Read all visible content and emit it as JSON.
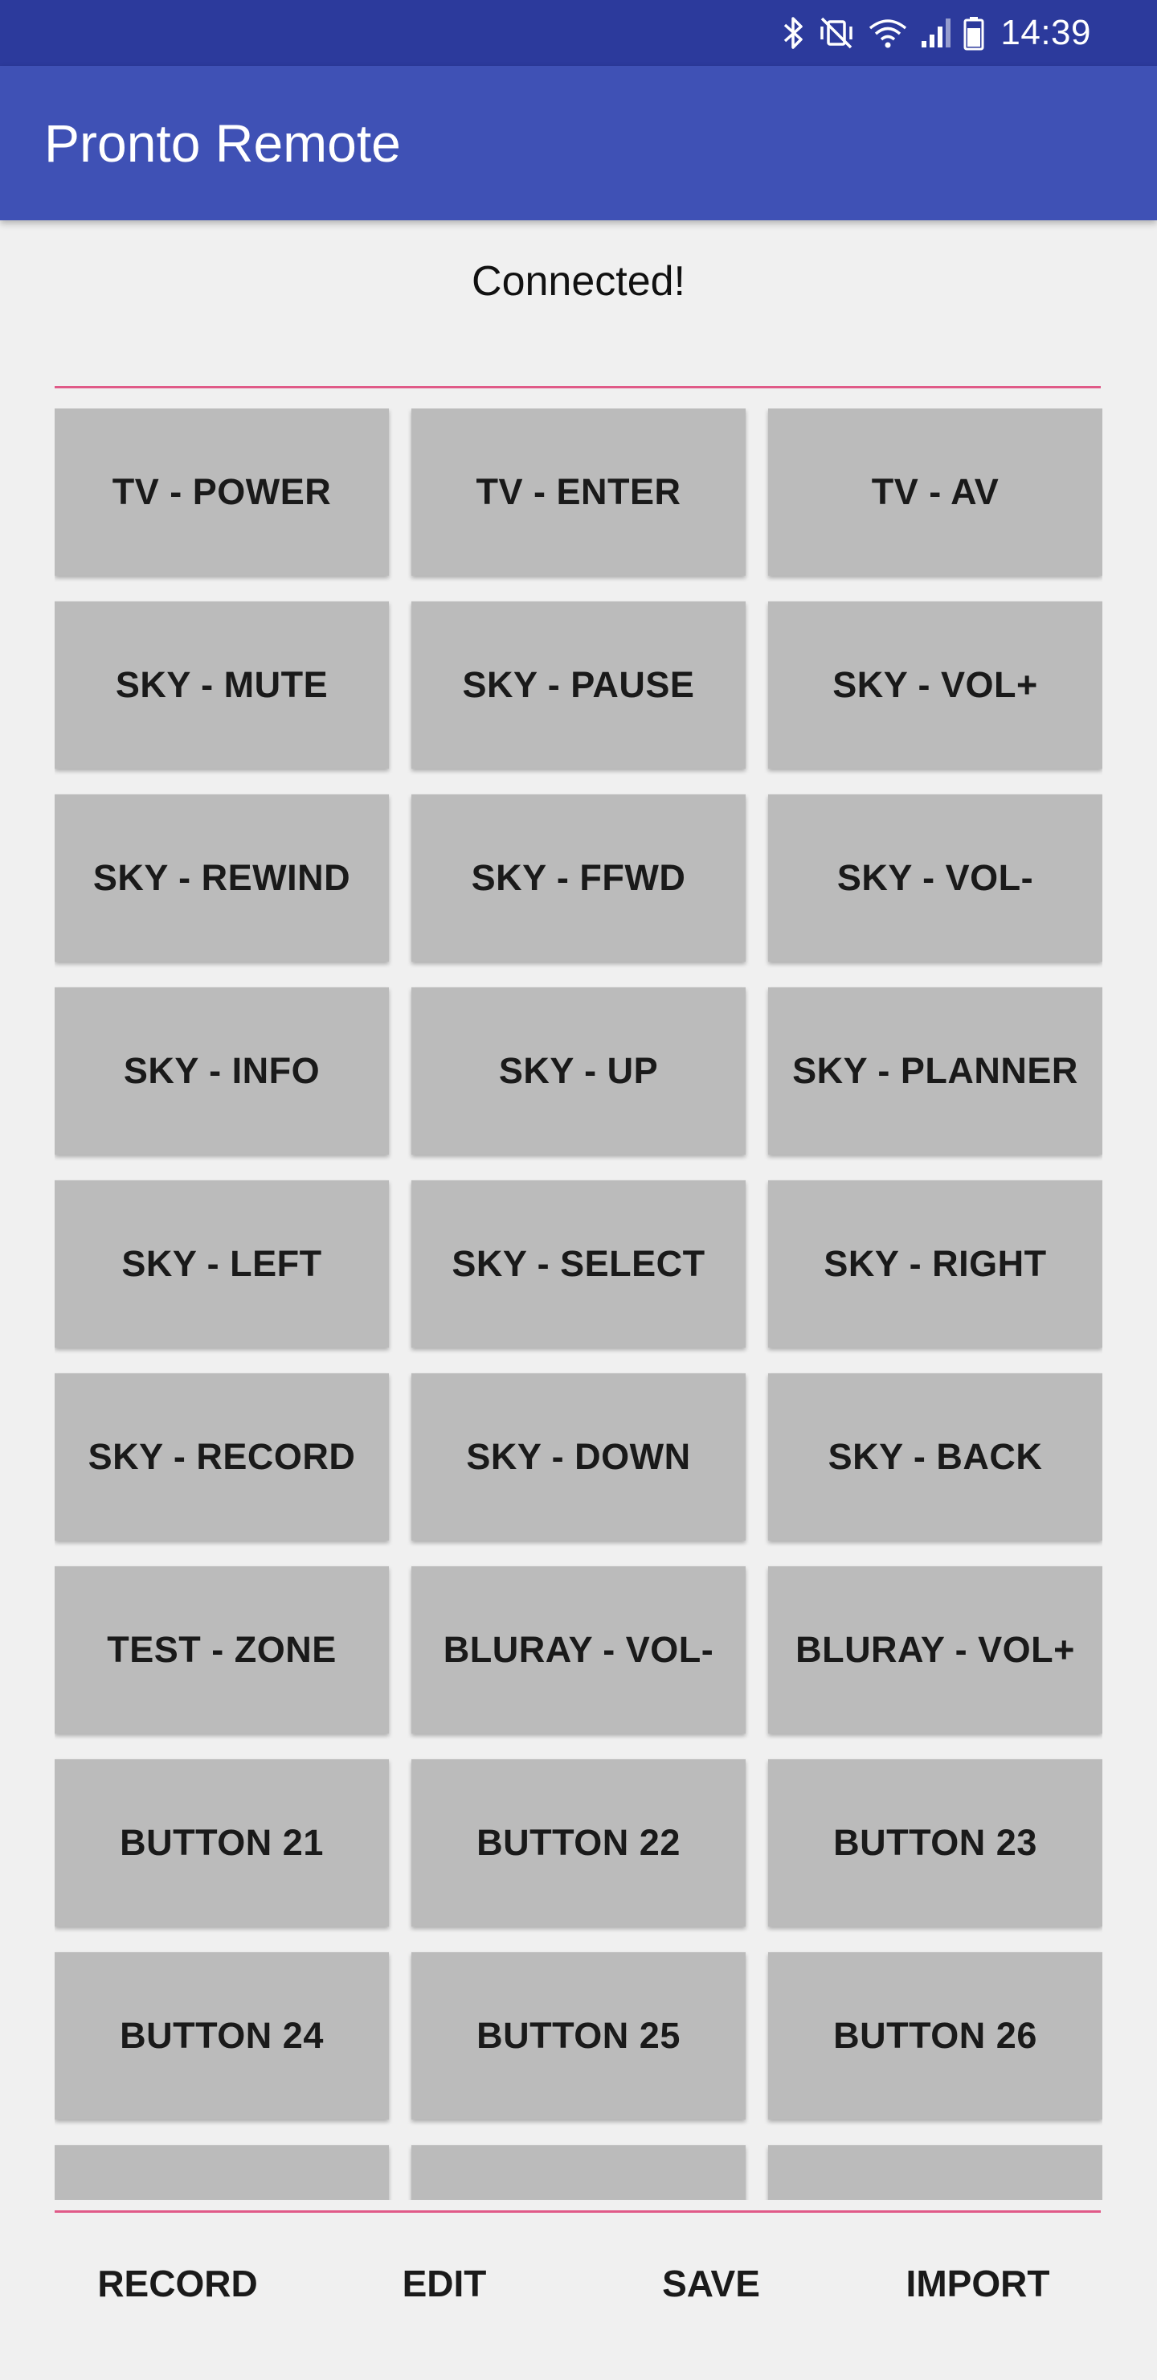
{
  "status_bar": {
    "time": "14:39",
    "icons": [
      "bluetooth-icon",
      "vibrate-mute-icon",
      "wifi-icon",
      "cell-signal-icon",
      "battery-icon"
    ]
  },
  "app_bar": {
    "title": "Pronto Remote"
  },
  "connection": {
    "status": "Connected!"
  },
  "buttons": [
    "TV - POWER",
    "TV - ENTER",
    "TV - AV",
    "SKY - MUTE",
    "SKY - PAUSE",
    "SKY - VOL+",
    "SKY - REWIND",
    "SKY - FFWD",
    "SKY - VOL-",
    "SKY - INFO",
    "SKY - UP",
    "SKY - PLANNER",
    "SKY - LEFT",
    "SKY - SELECT",
    "SKY - RIGHT",
    "SKY - RECORD",
    "SKY - DOWN",
    "SKY - BACK",
    "TEST - ZONE",
    "BLURAY - VOL-",
    "BLURAY - VOL+",
    "BUTTON 21",
    "BUTTON 22",
    "BUTTON 23",
    "BUTTON 24",
    "BUTTON 25",
    "BUTTON 26",
    "",
    "",
    ""
  ],
  "actions": {
    "record": "RECORD",
    "edit": "EDIT",
    "save": "SAVE",
    "import": "IMPORT"
  },
  "colors": {
    "status_bar": "#2c3a9c",
    "app_bar": "#3f51b5",
    "button": "#bbbbbb",
    "divider": "#e05a88",
    "background": "#f0f0f0"
  }
}
